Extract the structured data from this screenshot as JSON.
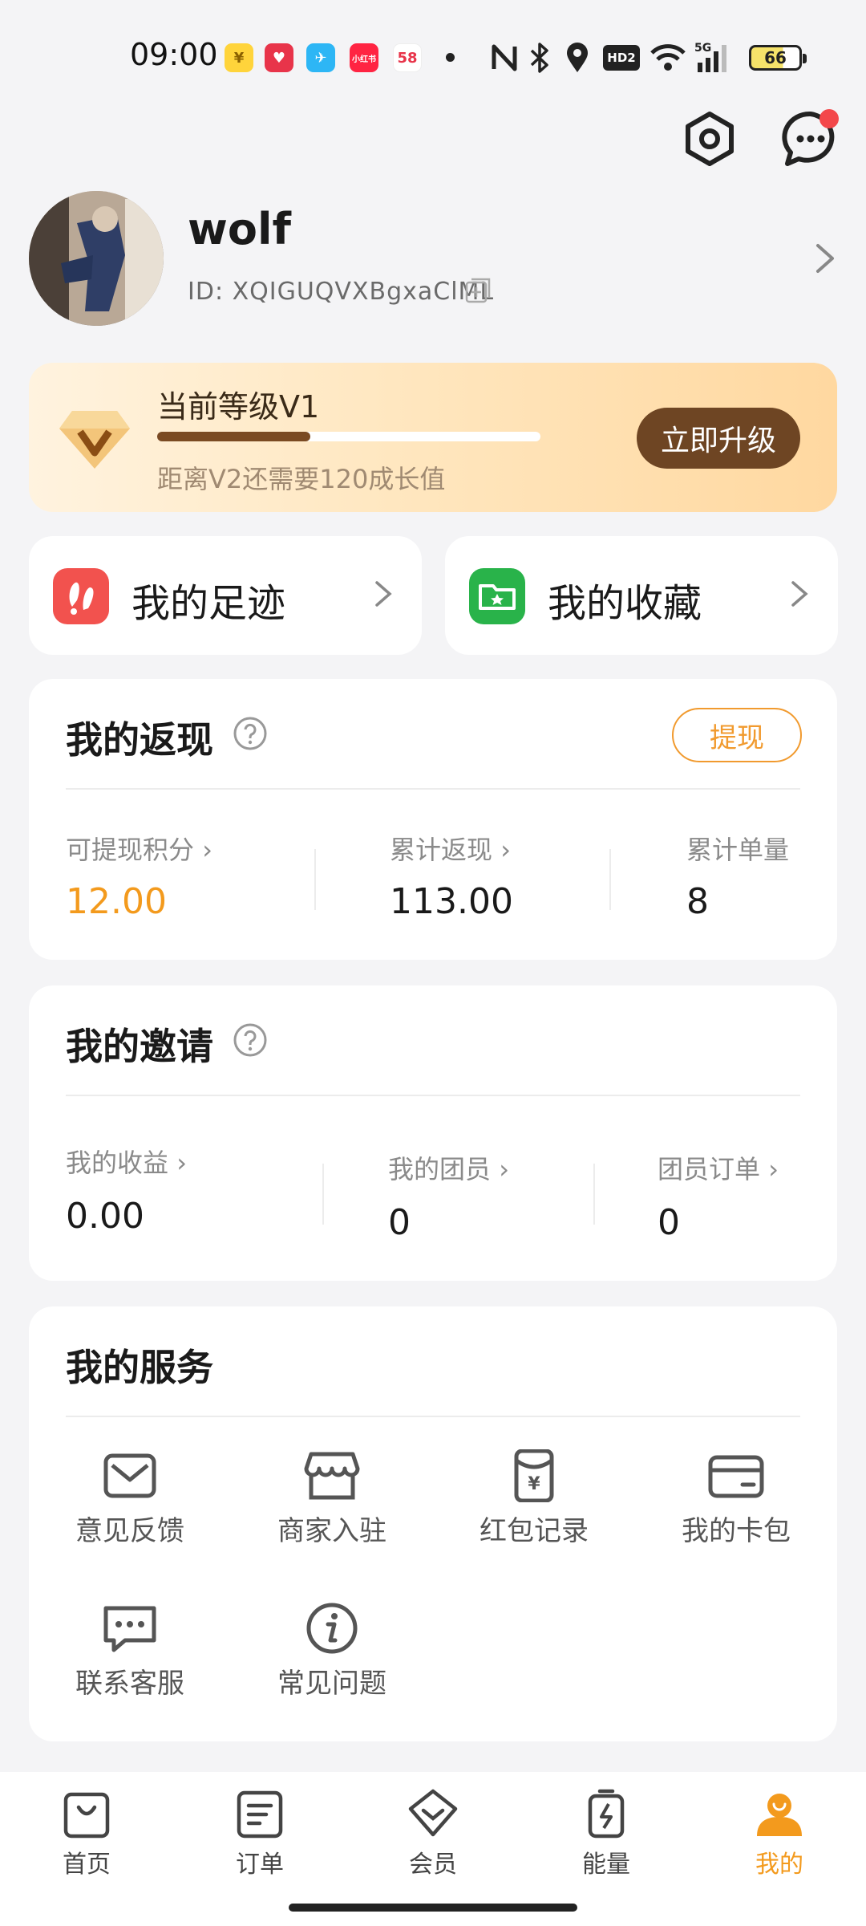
{
  "status_bar": {
    "time": "09:00",
    "battery": "66",
    "apps": [
      "¥",
      "♥",
      "✈",
      "小红书",
      "58"
    ]
  },
  "profile": {
    "name": "wolf",
    "id": "ID:  XQIGUQVXBgxaClML"
  },
  "level": {
    "title": "当前等级V1",
    "progress": 0.4,
    "desc": "距离V2还需要120成长值",
    "upgrade_label": "立即升级"
  },
  "quick": [
    {
      "label": "我的足迹",
      "icon": "footprint-icon",
      "color": "#f2524e"
    },
    {
      "label": "我的收藏",
      "icon": "folder-star-icon",
      "color": "#29b34a"
    }
  ],
  "cashback": {
    "title": "我的返现",
    "withdraw_label": "提现",
    "stats": [
      {
        "label": "可提现积分",
        "value": "12.00"
      },
      {
        "label": "累计返现",
        "value": "113.00"
      },
      {
        "label": "累计单量",
        "value": "8"
      }
    ]
  },
  "invite": {
    "title": "我的邀请",
    "stats": [
      {
        "label": "我的收益",
        "value": "0.00"
      },
      {
        "label": "我的团员",
        "value": "0"
      },
      {
        "label": "团员订单",
        "value": "0"
      }
    ]
  },
  "services": {
    "title": "我的服务",
    "items": [
      {
        "label": "意见反馈",
        "icon": "envelope-icon"
      },
      {
        "label": "商家入驻",
        "icon": "shop-icon"
      },
      {
        "label": "红包记录",
        "icon": "red-packet-icon"
      },
      {
        "label": "我的卡包",
        "icon": "wallet-card-icon"
      },
      {
        "label": "联系客服",
        "icon": "chat-bubble-icon"
      },
      {
        "label": "常见问题",
        "icon": "info-icon"
      }
    ]
  },
  "nav": [
    {
      "label": "首页",
      "icon": "shopping-bag-icon"
    },
    {
      "label": "订单",
      "icon": "order-list-icon"
    },
    {
      "label": "会员",
      "icon": "member-gem-icon"
    },
    {
      "label": "能量",
      "icon": "energy-battery-icon"
    },
    {
      "label": "我的",
      "icon": "profile-icon",
      "active": true
    }
  ],
  "colors": {
    "accent": "#f39a1d",
    "level_btn": "#6e4523",
    "cash_value": "#f39a1d"
  }
}
